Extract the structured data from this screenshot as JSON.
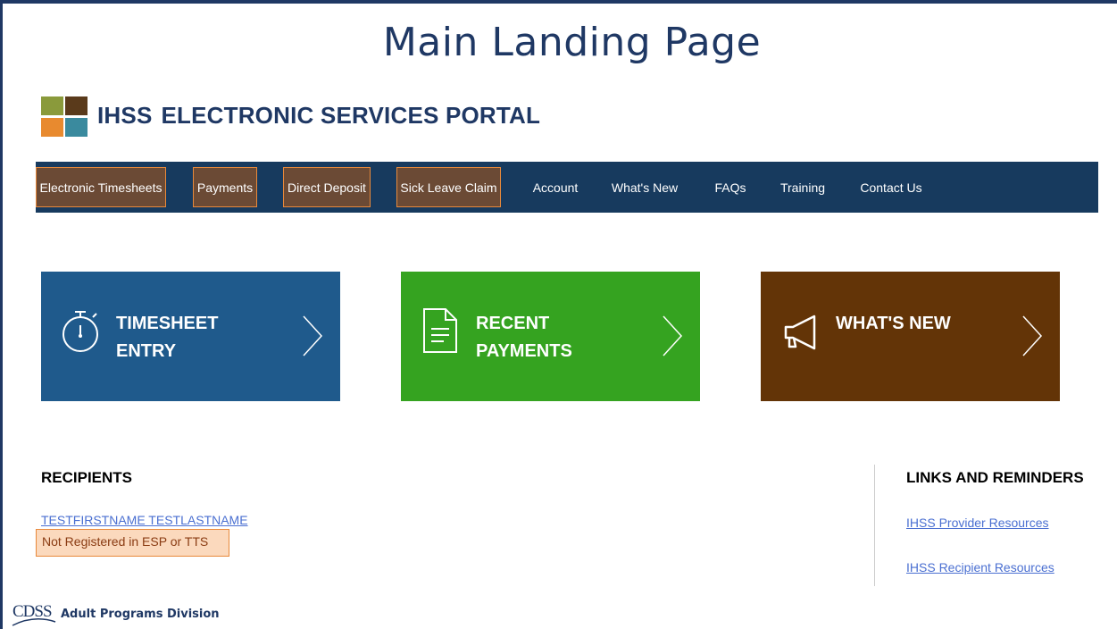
{
  "slide": {
    "title": "Main Landing Page"
  },
  "portal": {
    "brand_short": "IHSS",
    "brand_long": "ELECTRONIC SERVICES PORTAL"
  },
  "nav": {
    "items": [
      {
        "label": "Electronic Timesheets",
        "highlighted": true
      },
      {
        "label": "Payments",
        "highlighted": true
      },
      {
        "label": "Direct Deposit",
        "highlighted": true
      },
      {
        "label": "Sick Leave Claim",
        "highlighted": true
      },
      {
        "label": "Account",
        "highlighted": false
      },
      {
        "label": "What's New",
        "highlighted": false
      },
      {
        "label": "FAQs",
        "highlighted": false
      },
      {
        "label": "Training",
        "highlighted": false
      },
      {
        "label": "Contact Us",
        "highlighted": false
      }
    ]
  },
  "tiles": [
    {
      "line1": "TIMESHEET",
      "line2": "ENTRY",
      "icon": "stopwatch-icon",
      "color": "#1f5a8c"
    },
    {
      "line1": "RECENT",
      "line2": "PAYMENTS",
      "icon": "document-icon",
      "color": "#35a320"
    },
    {
      "line1": "WHAT'S NEW",
      "line2": "",
      "icon": "megaphone-icon",
      "color": "#633407"
    }
  ],
  "recipients": {
    "heading": "RECIPIENTS",
    "items": [
      {
        "name": "TESTFIRSTNAME TESTLASTNAME",
        "status": "Not Registered in ESP or TTS"
      }
    ]
  },
  "links": {
    "heading": "LINKS AND REMINDERS",
    "items": [
      {
        "label": "IHSS Provider Resources"
      },
      {
        "label": "IHSS Recipient Resources"
      }
    ]
  },
  "footer": {
    "logo_text": "CDSS",
    "division": "Adult Programs Division"
  },
  "colors": {
    "navy": "#173a5e",
    "highlight_border": "#e8893b",
    "link": "#4a6fd1"
  }
}
